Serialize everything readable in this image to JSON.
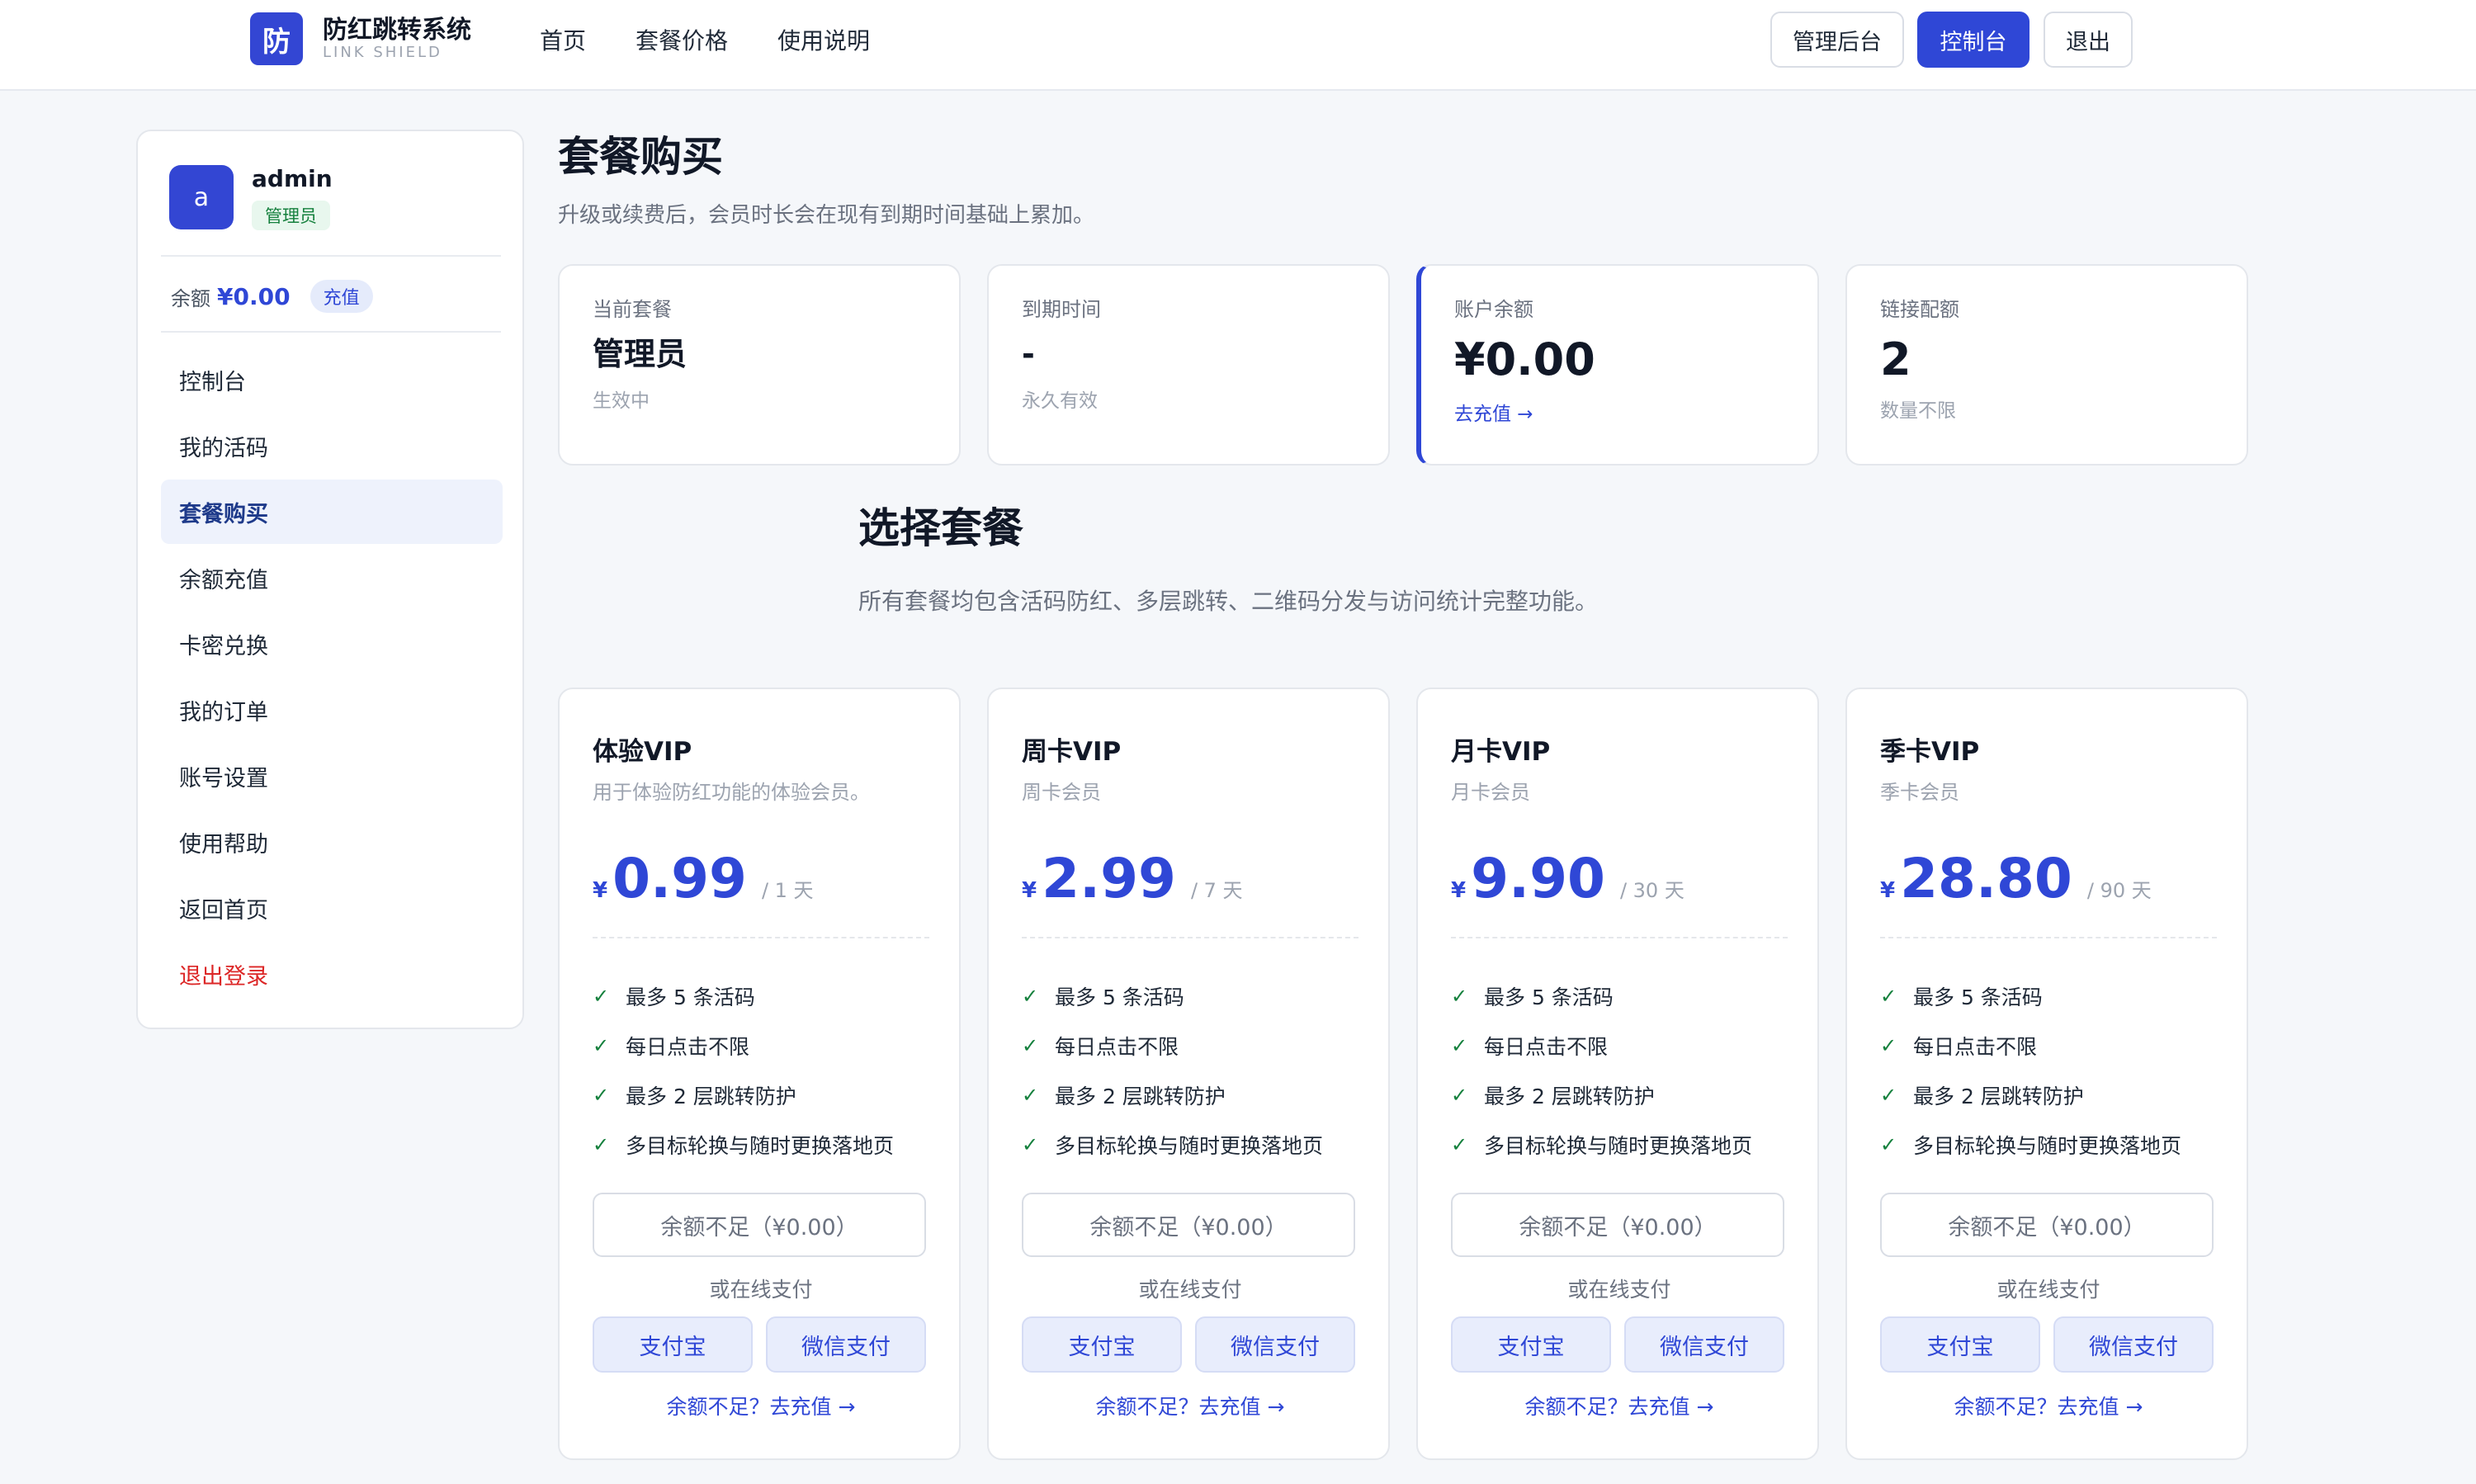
{
  "header": {
    "brand_logo": "防",
    "brand_name": "防红跳转系统",
    "brand_sub": "LINK SHIELD",
    "nav": [
      "首页",
      "套餐价格",
      "使用说明"
    ],
    "btn_admin": "管理后台",
    "btn_console": "控制台",
    "btn_logout": "退出"
  },
  "sidebar": {
    "avatar": "a",
    "username": "admin",
    "role": "管理员",
    "balance_label": "余额",
    "balance_value": "¥0.00",
    "recharge": "充值",
    "menu": [
      "控制台",
      "我的活码",
      "套餐购买",
      "余额充值",
      "卡密兑换",
      "我的订单",
      "账号设置",
      "使用帮助",
      "返回首页",
      "退出登录"
    ],
    "active_index": 2
  },
  "main": {
    "title": "套餐购买",
    "desc": "升级或续费后，会员时长会在现有到期时间基础上累加。",
    "stats": [
      {
        "label": "当前套餐",
        "value": "管理员",
        "sub": "生效中"
      },
      {
        "label": "到期时间",
        "value": "-",
        "sub": "永久有效"
      },
      {
        "label": "账户余额",
        "value": "¥0.00",
        "link": "去充值 →"
      },
      {
        "label": "链接配额",
        "value": "2",
        "sub": "数量不限"
      }
    ],
    "section_title": "选择套餐",
    "section_desc": "所有套餐均包含活码防红、多层跳转、二维码分发与访问统计完整功能。",
    "plans": [
      {
        "name": "体验VIP",
        "desc": "用于体验防红功能的体验会员。",
        "currency": "¥",
        "price": "0.99",
        "period": "/ 1 天"
      },
      {
        "name": "周卡VIP",
        "desc": "周卡会员",
        "currency": "¥",
        "price": "2.99",
        "period": "/ 7 天"
      },
      {
        "name": "月卡VIP",
        "desc": "月卡会员",
        "currency": "¥",
        "price": "9.90",
        "period": "/ 30 天"
      },
      {
        "name": "季卡VIP",
        "desc": "季卡会员",
        "currency": "¥",
        "price": "28.80",
        "period": "/ 90 天"
      }
    ],
    "features": [
      "最多 5 条活码",
      "每日点击不限",
      "最多 2 层跳转防护",
      "多目标轮换与随时更换落地页"
    ],
    "check_glyph": "✓",
    "insufficient": "余额不足（¥0.00）",
    "or_online": "或在线支付",
    "alipay": "支付宝",
    "wechat": "微信支付",
    "recharge_link": "余额不足？去充值 →"
  }
}
